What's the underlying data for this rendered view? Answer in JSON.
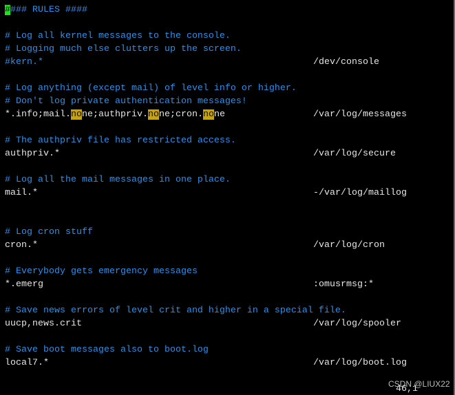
{
  "colors": {
    "background": "#000000",
    "text": "#e6e6e6",
    "comment": "#2f8fe8",
    "search_highlight": "#c9a400",
    "cursor": "#19e619"
  },
  "lines": [
    {
      "segments": [
        {
          "t": "#",
          "style": "cursor comment"
        },
        {
          "t": "### RULES ####",
          "style": "comment"
        }
      ]
    },
    {
      "segments": []
    },
    {
      "segments": [
        {
          "t": "# Log all kernel messages to the console.",
          "style": "comment"
        }
      ]
    },
    {
      "segments": [
        {
          "t": "# Logging much else clutters up the screen.",
          "style": "comment"
        }
      ]
    },
    {
      "segments": [
        {
          "t": "#kern.*",
          "style": "comment"
        }
      ],
      "dest": "/dev/console"
    },
    {
      "segments": []
    },
    {
      "segments": [
        {
          "t": "# Log anything (except mail) of level info or higher.",
          "style": "comment"
        }
      ]
    },
    {
      "segments": [
        {
          "t": "# Don't log private authentication messages!",
          "style": "comment"
        }
      ]
    },
    {
      "segments": [
        {
          "t": "*.info;mail.",
          "style": ""
        },
        {
          "t": "no",
          "style": "hl"
        },
        {
          "t": "ne;authpriv.",
          "style": ""
        },
        {
          "t": "no",
          "style": "hl"
        },
        {
          "t": "ne;cron.",
          "style": ""
        },
        {
          "t": "no",
          "style": "hl"
        },
        {
          "t": "ne",
          "style": ""
        }
      ],
      "dest": "/var/log/messages"
    },
    {
      "segments": []
    },
    {
      "segments": [
        {
          "t": "# The authpriv file has restricted access.",
          "style": "comment"
        }
      ]
    },
    {
      "segments": [
        {
          "t": "authpriv.*",
          "style": ""
        }
      ],
      "dest": "/var/log/secure"
    },
    {
      "segments": []
    },
    {
      "segments": [
        {
          "t": "# Log all the mail messages in one place.",
          "style": "comment"
        }
      ]
    },
    {
      "segments": [
        {
          "t": "mail.*",
          "style": ""
        }
      ],
      "dest": "-/var/log/maillog"
    },
    {
      "segments": []
    },
    {
      "segments": []
    },
    {
      "segments": [
        {
          "t": "# Log cron stuff",
          "style": "comment"
        }
      ]
    },
    {
      "segments": [
        {
          "t": "cron.*",
          "style": ""
        }
      ],
      "dest": "/var/log/cron"
    },
    {
      "segments": []
    },
    {
      "segments": [
        {
          "t": "# Everybody gets emergency messages",
          "style": "comment"
        }
      ]
    },
    {
      "segments": [
        {
          "t": "*.emerg",
          "style": ""
        }
      ],
      "dest": ":omusrmsg:*"
    },
    {
      "segments": []
    },
    {
      "segments": [
        {
          "t": "# Save news errors of level crit and higher in a special file.",
          "style": "comment"
        }
      ]
    },
    {
      "segments": [
        {
          "t": "uucp,news.crit",
          "style": ""
        }
      ],
      "dest": "/var/log/spooler"
    },
    {
      "segments": []
    },
    {
      "segments": [
        {
          "t": "# Save boot messages also to boot.log",
          "style": "comment"
        }
      ]
    },
    {
      "segments": [
        {
          "t": "local7.*",
          "style": ""
        }
      ],
      "dest": "/var/log/boot.log"
    }
  ],
  "status": {
    "cursor_position": "46,1"
  },
  "watermark": "CSDN @LIUX22"
}
